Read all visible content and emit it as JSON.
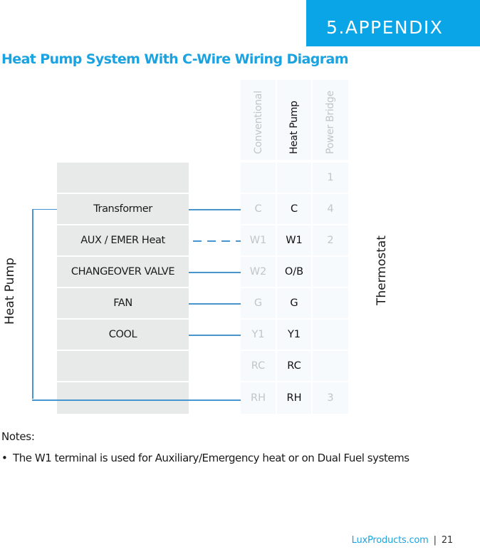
{
  "header": {
    "section_label": "5.APPENDIX",
    "accent_color": "#0aa5e6"
  },
  "title": "Heat Pump System With C-Wire Wiring Diagram",
  "diagram": {
    "left_label": "Heat Pump",
    "right_label": "Thermostat",
    "heat_pump_terminals": [
      "",
      "Transformer",
      "AUX / EMER Heat",
      "CHANGEOVER VALVE",
      "FAN",
      "COOL",
      "",
      ""
    ],
    "thermostat_columns": [
      {
        "header": "Conventional",
        "emphasis": "muted",
        "values": [
          "",
          "C",
          "W1",
          "W2",
          "G",
          "Y1",
          "RC",
          "RH"
        ]
      },
      {
        "header": "Heat Pump",
        "emphasis": "active",
        "values": [
          "",
          "C",
          "W1",
          "O/B",
          "G",
          "Y1",
          "RC",
          "RH"
        ]
      },
      {
        "header": "Power Bridge",
        "emphasis": "muted",
        "values": [
          "1",
          "4",
          "2",
          "",
          "",
          "",
          "",
          "3"
        ]
      }
    ],
    "wires": [
      {
        "from": "Transformer",
        "to": "C",
        "style": "solid"
      },
      {
        "from": "AUX / EMER Heat",
        "to": "W1",
        "style": "dashed"
      },
      {
        "from": "CHANGEOVER VALVE",
        "to": "O/B",
        "style": "solid"
      },
      {
        "from": "FAN",
        "to": "G",
        "style": "solid"
      },
      {
        "from": "COOL",
        "to": "Y1",
        "style": "solid"
      },
      {
        "from": "Transformer",
        "to": "RH",
        "style": "solid"
      }
    ],
    "wire_color": "#4896d1"
  },
  "notes": {
    "title": "Notes:",
    "bullet": "•",
    "items": [
      "The W1 terminal is used for Auxiliary/Emergency heat or on Dual Fuel systems"
    ]
  },
  "footer": {
    "site": "LuxProducts.com",
    "separator": "|",
    "page_number": "21"
  }
}
